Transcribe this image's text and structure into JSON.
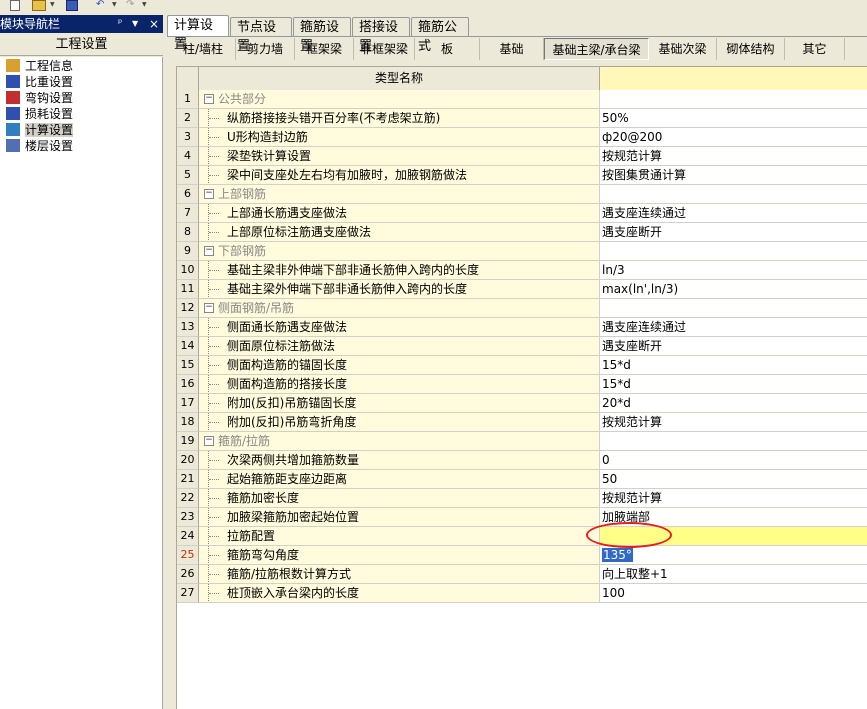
{
  "toolbar": {
    "new": "new-file-icon",
    "open": "folder-open-icon",
    "save": "save-icon",
    "undo": "undo-icon",
    "redo": "redo-icon"
  },
  "nav": {
    "title": "模块导航栏",
    "pin": "ᵖ",
    "drop": "▼",
    "close": "×",
    "section": "工程设置",
    "items": [
      {
        "label": "工程信息",
        "color": "#d8a030"
      },
      {
        "label": "比重设置",
        "color": "#3050b0"
      },
      {
        "label": "弯钩设置",
        "color": "#c03030"
      },
      {
        "label": "损耗设置",
        "color": "#3050b0"
      },
      {
        "label": "计算设置",
        "color": "#3080c0"
      },
      {
        "label": "楼层设置",
        "color": "#5070b0"
      }
    ]
  },
  "tabs": [
    "计算设置",
    "节点设置",
    "箍筋设置",
    "搭接设置",
    "箍筋公式"
  ],
  "subtabs": [
    "柱/墙柱",
    "剪力墙",
    "框架梁",
    "非框架梁",
    "板",
    "基础",
    "基础主梁/承台梁",
    "基础次梁",
    "砌体结构",
    "其它"
  ],
  "grid": {
    "header_name": "类型名称",
    "expander_minus": "−",
    "rows": [
      {
        "num": "1",
        "name": "公共部分",
        "value": ""
      },
      {
        "num": "2",
        "name": "纵筋搭接接头错开百分率(不考虑架立筋)",
        "value": "50%"
      },
      {
        "num": "3",
        "name": "U形构造封边筋",
        "value": "ф20@200"
      },
      {
        "num": "4",
        "name": "梁垫铁计算设置",
        "value": "按规范计算"
      },
      {
        "num": "5",
        "name": "梁中间支座处左右均有加腋时，加腋钢筋做法",
        "value": "按图集贯通计算"
      },
      {
        "num": "6",
        "name": "上部钢筋",
        "value": ""
      },
      {
        "num": "7",
        "name": "上部通长筋遇支座做法",
        "value": "遇支座连续通过"
      },
      {
        "num": "8",
        "name": "上部原位标注筋遇支座做法",
        "value": "遇支座断开"
      },
      {
        "num": "9",
        "name": "下部钢筋",
        "value": ""
      },
      {
        "num": "10",
        "name": "基础主梁非外伸端下部非通长筋伸入跨内的长度",
        "value": "ln/3"
      },
      {
        "num": "11",
        "name": "基础主梁外伸端下部非通长筋伸入跨内的长度",
        "value": "max(ln',ln/3)"
      },
      {
        "num": "12",
        "name": "侧面钢筋/吊筋",
        "value": ""
      },
      {
        "num": "13",
        "name": "侧面通长筋遇支座做法",
        "value": "遇支座连续通过"
      },
      {
        "num": "14",
        "name": "侧面原位标注筋做法",
        "value": "遇支座断开"
      },
      {
        "num": "15",
        "name": "侧面构造筋的锚固长度",
        "value": "15*d"
      },
      {
        "num": "16",
        "name": "侧面构造筋的搭接长度",
        "value": "15*d"
      },
      {
        "num": "17",
        "name": "附加(反扣)吊筋锚固长度",
        "value": "20*d"
      },
      {
        "num": "18",
        "name": "附加(反扣)吊筋弯折角度",
        "value": "按规范计算"
      },
      {
        "num": "19",
        "name": "箍筋/拉筋",
        "value": ""
      },
      {
        "num": "20",
        "name": "次梁两侧共增加箍筋数量",
        "value": "0"
      },
      {
        "num": "21",
        "name": "起始箍筋距支座边距离",
        "value": "50"
      },
      {
        "num": "22",
        "name": "箍筋加密长度",
        "value": "按规范计算"
      },
      {
        "num": "23",
        "name": "加腋梁箍筋加密起始位置",
        "value": "加腋端部"
      },
      {
        "num": "24",
        "name": "拉筋配置",
        "value": ""
      },
      {
        "num": "25",
        "name": "箍筋弯勾角度",
        "value": "135°"
      },
      {
        "num": "26",
        "name": "箍筋/拉筋根数计算方式",
        "value": "向上取整+1"
      },
      {
        "num": "27",
        "name": "桩顶嵌入承台梁内的长度",
        "value": "100"
      }
    ]
  }
}
